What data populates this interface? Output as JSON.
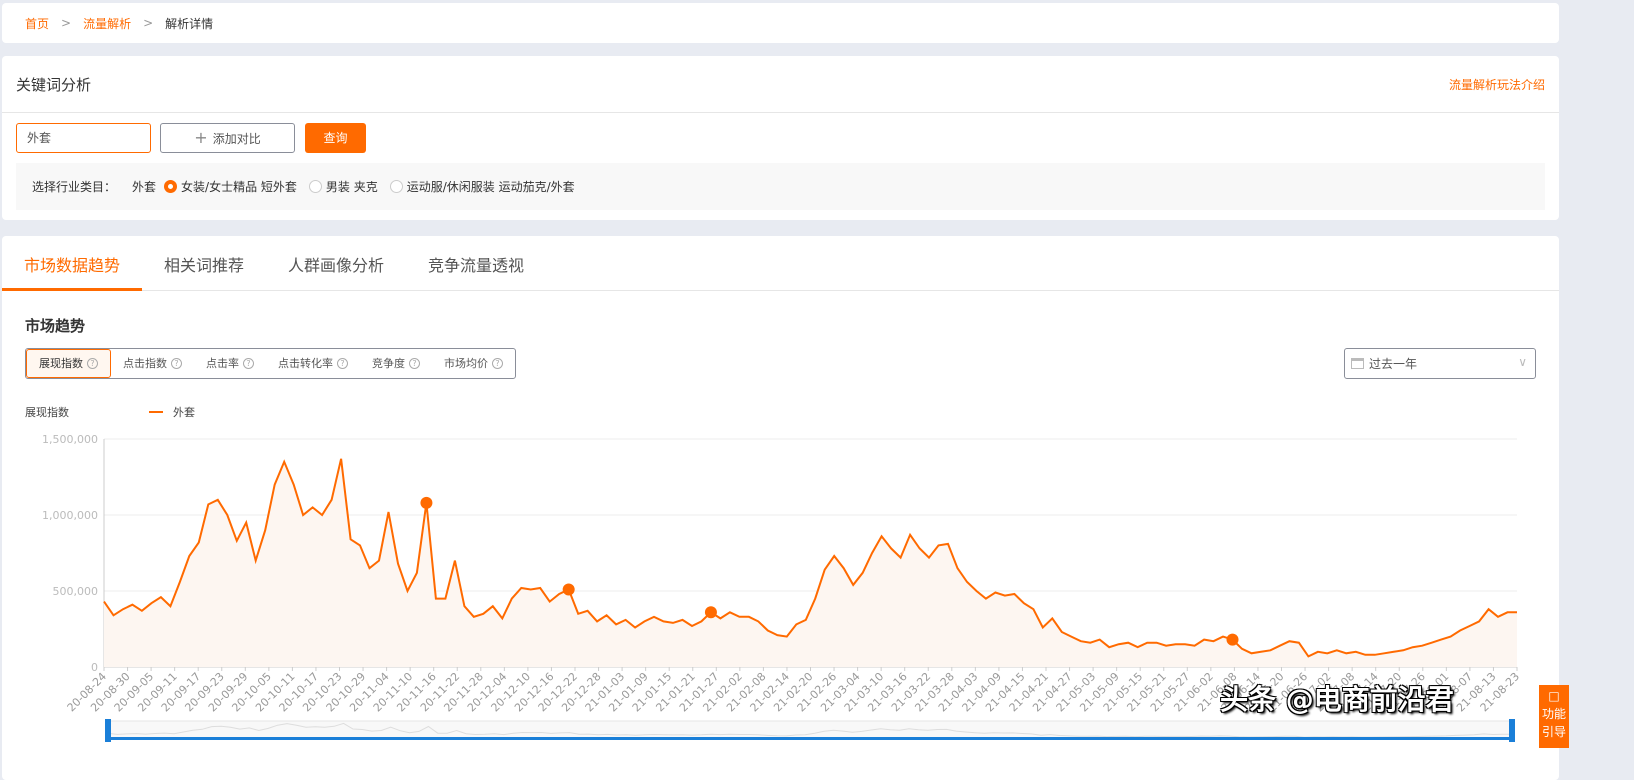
{
  "breadcrumb": [
    "首页",
    "流量解析",
    "解析详情"
  ],
  "keyword": {
    "title": "关键词分析",
    "intro_link": "流量解析玩法介绍",
    "input_value": "外套",
    "add_compare": "添加对比",
    "query": "查询",
    "category_label": "选择行业类目：",
    "category_keyword": "外套",
    "categories": [
      {
        "label": "女装/女士精品 短外套",
        "selected": true
      },
      {
        "label": "男装 夹克",
        "selected": false
      },
      {
        "label": "运动服/休闲服装 运动茄克/外套",
        "selected": false
      }
    ]
  },
  "tabs": [
    "市场数据趋势",
    "相关词推荐",
    "人群画像分析",
    "竞争流量透视"
  ],
  "section_title": "市场趋势",
  "metrics": [
    "展现指数",
    "点击指数",
    "点击率",
    "点击转化率",
    "竞争度",
    "市场均价"
  ],
  "range": "过去一年",
  "colors": {
    "accent": "#ff6a00",
    "slider": "#1a7fd8"
  },
  "chart_data": {
    "type": "area",
    "ylabel": "展现指数",
    "legend": [
      "外套"
    ],
    "ylim": [
      0,
      1500000
    ],
    "yticks": [
      "0",
      "500,000",
      "1,000,000",
      "1,500,000"
    ],
    "xticks": [
      "20-08-24",
      "20-08-30",
      "20-09-05",
      "20-09-11",
      "20-09-17",
      "20-09-23",
      "20-09-29",
      "20-10-05",
      "20-10-11",
      "20-10-17",
      "20-10-23",
      "20-10-29",
      "20-11-04",
      "20-11-10",
      "20-11-16",
      "20-11-22",
      "20-11-28",
      "20-12-04",
      "20-12-10",
      "20-12-16",
      "20-12-22",
      "20-12-28",
      "21-01-03",
      "21-01-09",
      "21-01-15",
      "21-01-21",
      "21-01-27",
      "21-02-02",
      "21-02-08",
      "21-02-14",
      "21-02-20",
      "21-02-26",
      "21-03-04",
      "21-03-10",
      "21-03-16",
      "21-03-22",
      "21-03-28",
      "21-04-03",
      "21-04-09",
      "21-04-15",
      "21-04-21",
      "21-04-27",
      "21-05-03",
      "21-05-09",
      "21-05-15",
      "21-05-21",
      "21-05-27",
      "21-06-02",
      "21-06-08",
      "21-06-14",
      "21-06-20",
      "21-06-26",
      "21-07-02",
      "21-07-08",
      "21-07-14",
      "21-07-20",
      "21-07-26",
      "21-08-01",
      "21-08-07",
      "21-08-13",
      "21-08-23"
    ],
    "values": [
      430000,
      340000,
      380000,
      410000,
      370000,
      420000,
      460000,
      400000,
      560000,
      730000,
      820000,
      1070000,
      1100000,
      1000000,
      830000,
      950000,
      700000,
      900000,
      1200000,
      1350000,
      1200000,
      1000000,
      1050000,
      1000000,
      1100000,
      1370000,
      840000,
      800000,
      650000,
      700000,
      1020000,
      680000,
      500000,
      620000,
      1080000,
      450000,
      450000,
      700000,
      400000,
      330000,
      350000,
      400000,
      320000,
      450000,
      520000,
      510000,
      520000,
      430000,
      480000,
      510000,
      350000,
      370000,
      300000,
      340000,
      280000,
      310000,
      260000,
      300000,
      330000,
      300000,
      290000,
      310000,
      270000,
      300000,
      360000,
      320000,
      360000,
      330000,
      330000,
      300000,
      240000,
      210000,
      200000,
      280000,
      310000,
      450000,
      640000,
      730000,
      650000,
      540000,
      620000,
      750000,
      860000,
      780000,
      720000,
      870000,
      780000,
      720000,
      800000,
      810000,
      650000,
      560000,
      500000,
      450000,
      490000,
      470000,
      480000,
      420000,
      380000,
      260000,
      320000,
      230000,
      200000,
      170000,
      160000,
      180000,
      130000,
      150000,
      160000,
      130000,
      160000,
      160000,
      140000,
      150000,
      150000,
      140000,
      180000,
      170000,
      200000,
      180000,
      120000,
      90000,
      100000,
      110000,
      140000,
      170000,
      160000,
      70000,
      100000,
      90000,
      110000,
      90000,
      100000,
      80000,
      80000,
      90000,
      100000,
      110000,
      130000,
      140000,
      160000,
      180000,
      200000,
      240000,
      270000,
      300000,
      380000,
      330000,
      360000,
      360000
    ],
    "marker_indices": [
      34,
      49,
      64,
      119
    ]
  },
  "watermark": "头条 @电商前沿君",
  "guide": [
    "功能",
    "引导"
  ]
}
